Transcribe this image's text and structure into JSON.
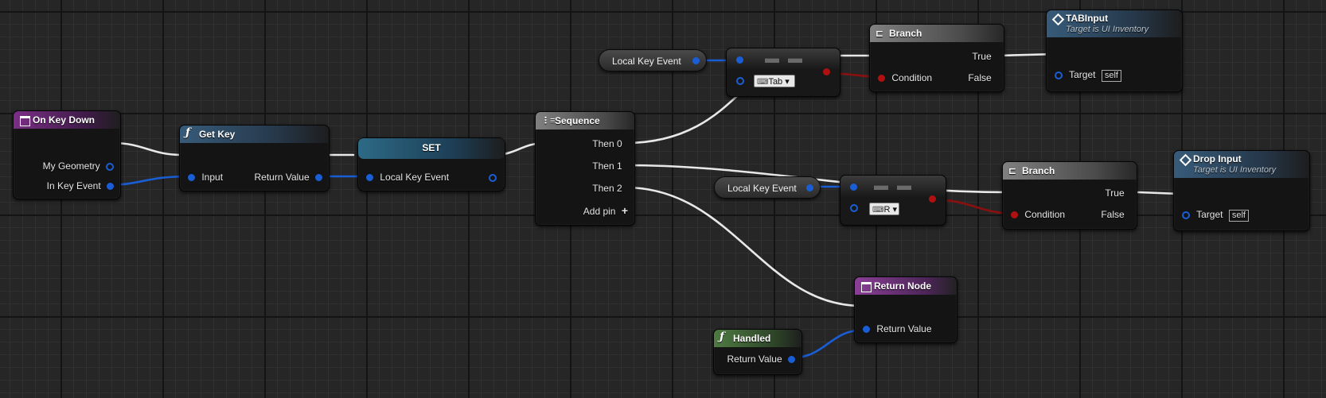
{
  "nodes": {
    "on_key_down": {
      "title": "On Key Down",
      "pins": [
        "My Geometry",
        "In Key Event"
      ]
    },
    "get_key": {
      "title": "Get Key",
      "input": "Input",
      "output": "Return Value"
    },
    "set": {
      "title": "SET",
      "pin": "Local Key Event"
    },
    "sequence": {
      "title": "Sequence",
      "pins": [
        "Then 0",
        "Then 1",
        "Then 2"
      ],
      "add_pin": "Add pin"
    },
    "var_tab": {
      "label": "Local Key Event"
    },
    "eq_tab": {
      "key": "Tab"
    },
    "branch_1": {
      "title": "Branch",
      "condition": "Condition",
      "true": "True",
      "false": "False"
    },
    "tab_input": {
      "title": "TABInput",
      "subtitle": "Target is UI Inventory",
      "target": "Target",
      "self": "self"
    },
    "var_r": {
      "label": "Local Key Event"
    },
    "eq_r": {
      "key": "R"
    },
    "branch_2": {
      "title": "Branch",
      "condition": "Condition",
      "true": "True",
      "false": "False"
    },
    "drop_input": {
      "title": "Drop Input",
      "subtitle": "Target is UI Inventory",
      "target": "Target",
      "self": "self"
    },
    "return_node": {
      "title": "Return Node",
      "pin": "Return Value"
    },
    "handled": {
      "title": "Handled",
      "pin": "Return Value"
    }
  },
  "colors": {
    "exec": "#ffffff",
    "struct": "#1a5ed6",
    "bool": "#b01010"
  }
}
